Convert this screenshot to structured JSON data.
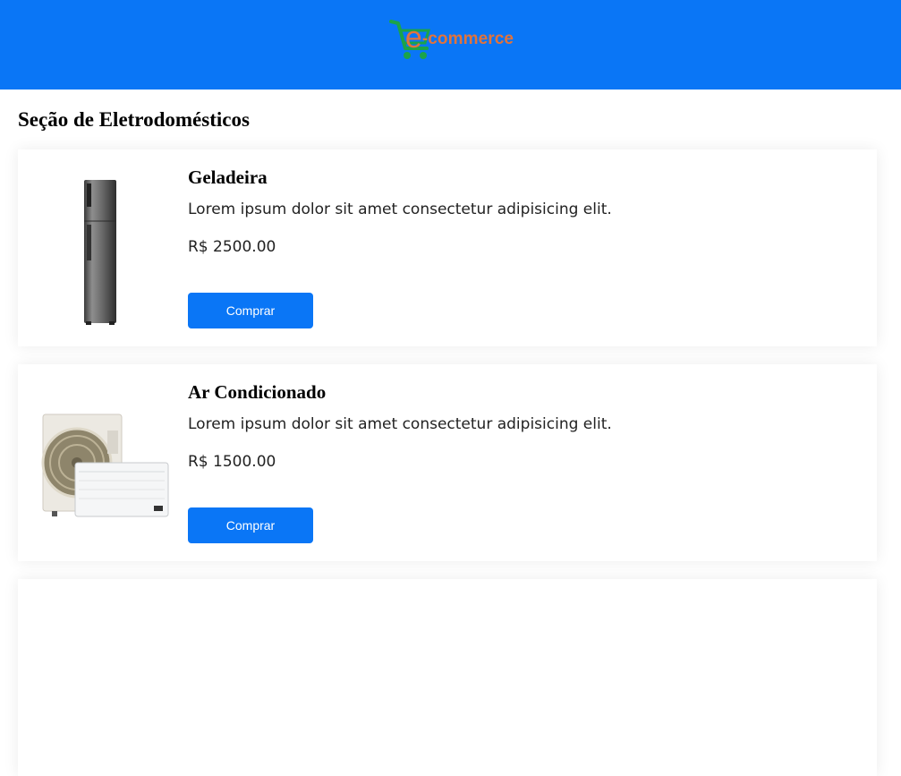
{
  "header": {
    "logo_letter": "e",
    "logo_text": "-commerce",
    "background_color": "#0a76f6",
    "logo_color": "#e1733c",
    "cart_icon": "shopping-cart-icon",
    "cart_color": "#1ba34a"
  },
  "section": {
    "title": "Seção de Eletrodomésticos"
  },
  "products": [
    {
      "name": "Geladeira",
      "description": "Lorem ipsum dolor sit amet consectetur adipisicing elit.",
      "price": "R$ 2500.00",
      "button_label": "Comprar",
      "image": "refrigerator-image"
    },
    {
      "name": "Ar Condicionado",
      "description": "Lorem ipsum dolor sit amet consectetur adipisicing elit.",
      "price": "R$ 1500.00",
      "button_label": "Comprar",
      "image": "air-conditioner-image"
    }
  ]
}
